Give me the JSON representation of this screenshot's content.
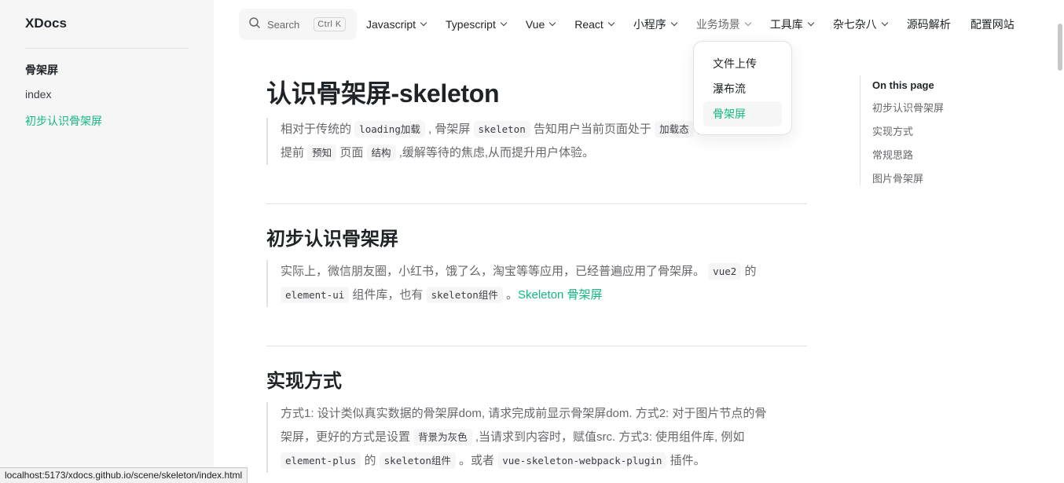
{
  "sidebar": {
    "brand": "XDocs",
    "group": "骨架屏",
    "items": [
      {
        "label": "index"
      },
      {
        "label": "初步认识骨架屏"
      }
    ]
  },
  "search": {
    "placeholder": "Search",
    "shortcut": "Ctrl K"
  },
  "nav": {
    "items": [
      {
        "label": "Javascript"
      },
      {
        "label": "Typescript"
      },
      {
        "label": "Vue"
      },
      {
        "label": "React"
      },
      {
        "label": "小程序"
      },
      {
        "label": "业务场景"
      },
      {
        "label": "工具库"
      },
      {
        "label": "杂七杂八"
      },
      {
        "label": "源码解析"
      },
      {
        "label": "配置网站"
      }
    ],
    "dropdown": {
      "items": [
        {
          "label": "文件上传"
        },
        {
          "label": "瀑布流"
        },
        {
          "label": "骨架屏"
        }
      ]
    }
  },
  "article": {
    "title": "认识骨架屏-skeleton",
    "intro": {
      "t1": "相对于传统的 ",
      "c1": "loading加载",
      "t2": " , 骨架屏 ",
      "c2": "skeleton",
      "t3": " 告知用户当前页面处于 ",
      "c3": "加载态",
      "t4": " ,",
      "t5": "提前 ",
      "c4": "预知",
      "t6": " 页面 ",
      "c5": "结构",
      "t7": " ,缓解等待的焦虑,从而提升用户体验。"
    },
    "sections": [
      {
        "heading": "初步认识骨架屏",
        "p": {
          "t1": "实际上，微信朋友圈，小红书，饿了么，淘宝等等应用，已经普遍应用了骨架屏。 ",
          "c1": "vue2",
          "t2": " 的",
          "c2": "element-ui",
          "t3": " 组件库，也有 ",
          "c3": "skeleton组件",
          "t4": " 。",
          "link": "Skeleton 骨架屏"
        }
      },
      {
        "heading": "实现方式",
        "p": {
          "t1": "方式1: 设计类似真实数据的骨架屏dom, 请求完成前显示骨架屏dom. 方式2: 对于图片节点的骨",
          "t2": "架屏，更好的方式是设置 ",
          "c1": "背景为灰色",
          "t3": " ,当请求到内容时，赋值src. 方式3: 使用组件库, 例如",
          "c2": "element-plus",
          "t4": " 的 ",
          "c3": "skeleton组件",
          "t5": " 。或者 ",
          "c4": "vue-skeleton-webpack-plugin",
          "t6": " 插件。"
        }
      }
    ]
  },
  "outline": {
    "title": "On this page",
    "items": [
      {
        "label": "初步认识骨架屏"
      },
      {
        "label": "实现方式"
      },
      {
        "label": "常规思路"
      },
      {
        "label": "图片骨架屏"
      }
    ]
  },
  "status_url": "localhost:5173/xdocs.github.io/scene/skeleton/index.html",
  "colors": {
    "accent": "#10b981",
    "sidebar_bg": "#f6f6f7",
    "text": "#3c3c43"
  }
}
